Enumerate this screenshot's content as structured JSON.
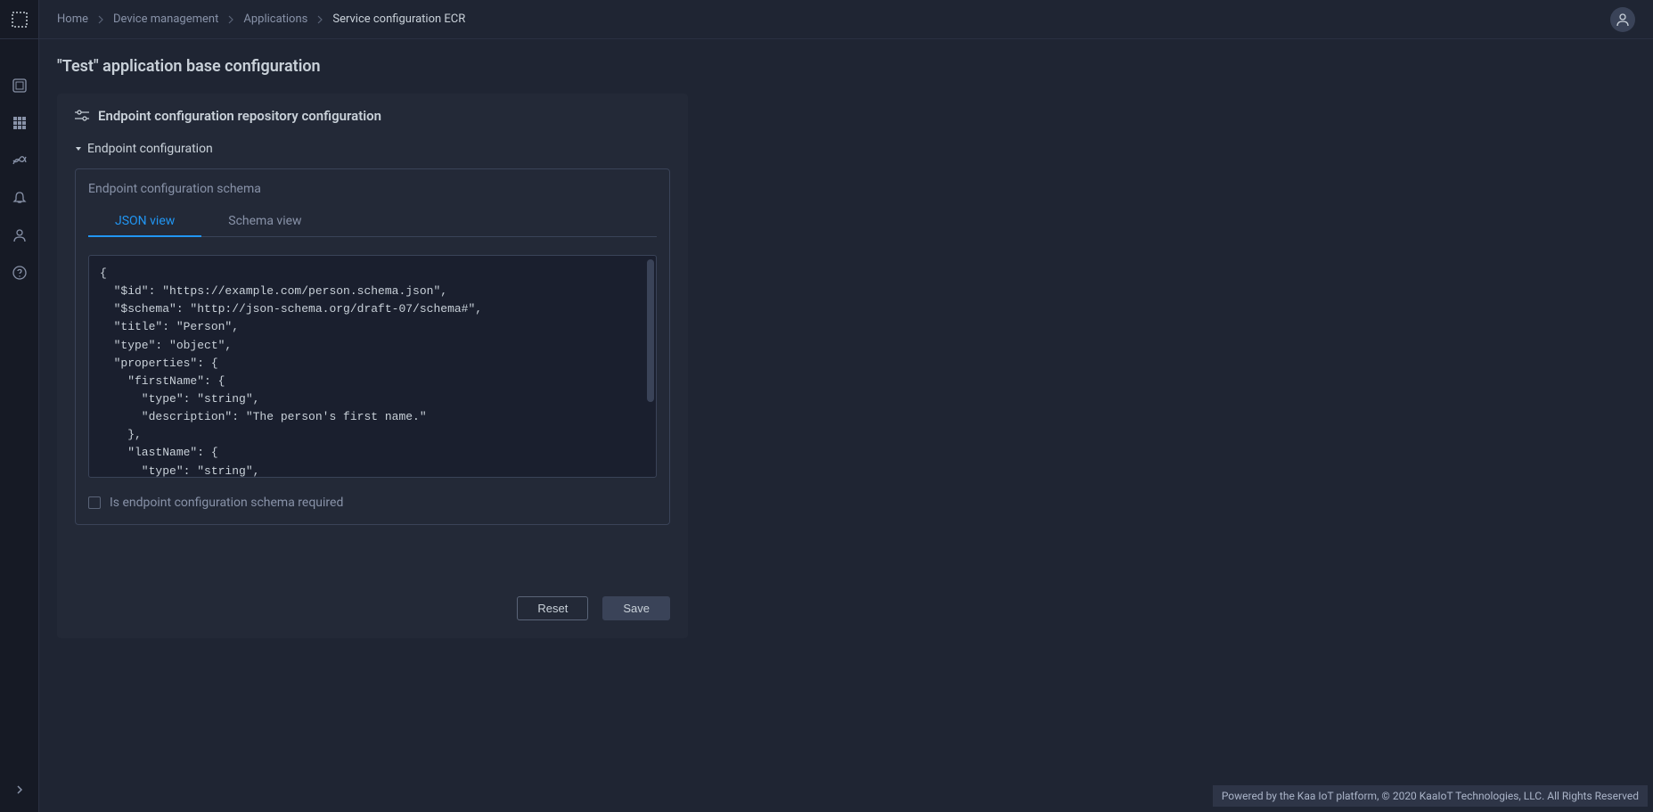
{
  "breadcrumbs": {
    "home": "Home",
    "device_management": "Device management",
    "applications": "Applications",
    "current": "Service configuration ECR"
  },
  "page_title": "\"Test\" application base configuration",
  "card": {
    "title": "Endpoint configuration repository configuration",
    "section": "Endpoint configuration",
    "schema_label": "Endpoint configuration schema",
    "tabs": {
      "json": "JSON view",
      "schema": "Schema view"
    },
    "code": "{\n  \"$id\": \"https://example.com/person.schema.json\",\n  \"$schema\": \"http://json-schema.org/draft-07/schema#\",\n  \"title\": \"Person\",\n  \"type\": \"object\",\n  \"properties\": {\n    \"firstName\": {\n      \"type\": \"string\",\n      \"description\": \"The person's first name.\"\n    },\n    \"lastName\": {\n      \"type\": \"string\",",
    "checkbox_label": "Is endpoint configuration schema required",
    "reset_button": "Reset",
    "save_button": "Save"
  },
  "footer": "Powered by the Kaa IoT platform, © 2020 KaaIoT Technologies, LLC. All Rights Reserved"
}
